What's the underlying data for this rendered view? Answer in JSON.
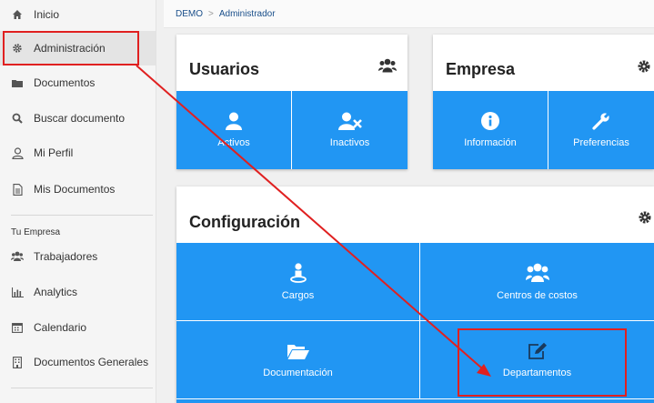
{
  "sidebar": {
    "items": [
      {
        "label": "Inicio",
        "icon": "home-icon"
      },
      {
        "label": "Administración",
        "icon": "gear-icon"
      },
      {
        "label": "Documentos",
        "icon": "folder-icon"
      },
      {
        "label": "Buscar documento",
        "icon": "search-icon"
      },
      {
        "label": "Mi Perfil",
        "icon": "user-icon"
      },
      {
        "label": "Mis Documentos",
        "icon": "document-icon"
      }
    ],
    "section_title": "Tu Empresa",
    "section_items": [
      {
        "label": "Trabajadores",
        "icon": "users-icon"
      },
      {
        "label": "Analytics",
        "icon": "bar-chart-icon"
      },
      {
        "label": "Calendario",
        "icon": "calendar-icon"
      },
      {
        "label": "Documentos Generales",
        "icon": "building-icon"
      }
    ]
  },
  "breadcrumb": {
    "root": "DEMO",
    "separator": ">",
    "current": "Administrador"
  },
  "usuarios": {
    "title": "Usuarios",
    "tiles": [
      {
        "label": "Activos"
      },
      {
        "label": "Inactivos"
      }
    ]
  },
  "empresa": {
    "title": "Empresa",
    "tiles": [
      {
        "label": "Información"
      },
      {
        "label": "Preferencias"
      }
    ]
  },
  "configuracion": {
    "title": "Configuración",
    "tiles": [
      {
        "label": "Cargos"
      },
      {
        "label": "Centros de costos"
      },
      {
        "label": "Documentación"
      },
      {
        "label": "Departamentos"
      }
    ]
  },
  "colors": {
    "tile_blue": "#2196f3",
    "annotation_red": "#e02020"
  }
}
